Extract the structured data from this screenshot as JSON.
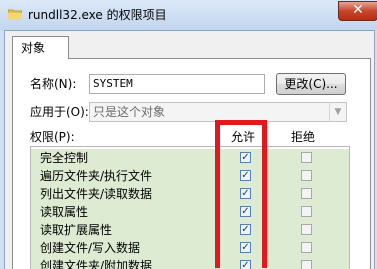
{
  "window": {
    "title": "rundll32.exe 的权限项目",
    "close_glyph": "✕"
  },
  "tabs": [
    {
      "label": "对象"
    }
  ],
  "form": {
    "name_label": "名称(N):",
    "name_value": "SYSTEM",
    "change_button": "更改(C)...",
    "apply_label": "应用于(O):",
    "apply_value": "只是这个对象"
  },
  "permissions": {
    "header": "权限(P):",
    "allow_header": "允许",
    "deny_header": "拒绝",
    "rows": [
      {
        "name": "完全控制",
        "allow": true,
        "deny": false
      },
      {
        "name": "遍历文件夹/执行文件",
        "allow": true,
        "deny": false
      },
      {
        "name": "列出文件夹/读取数据",
        "allow": true,
        "deny": false
      },
      {
        "name": "读取属性",
        "allow": true,
        "deny": false
      },
      {
        "name": "读取扩展属性",
        "allow": true,
        "deny": false
      },
      {
        "name": "创建文件/写入数据",
        "allow": true,
        "deny": false
      },
      {
        "name": "创建文件夹/附加数据",
        "allow": true,
        "deny": false
      }
    ]
  },
  "colors": {
    "highlight": "#e4171c",
    "row_background": "#ddebd2"
  }
}
